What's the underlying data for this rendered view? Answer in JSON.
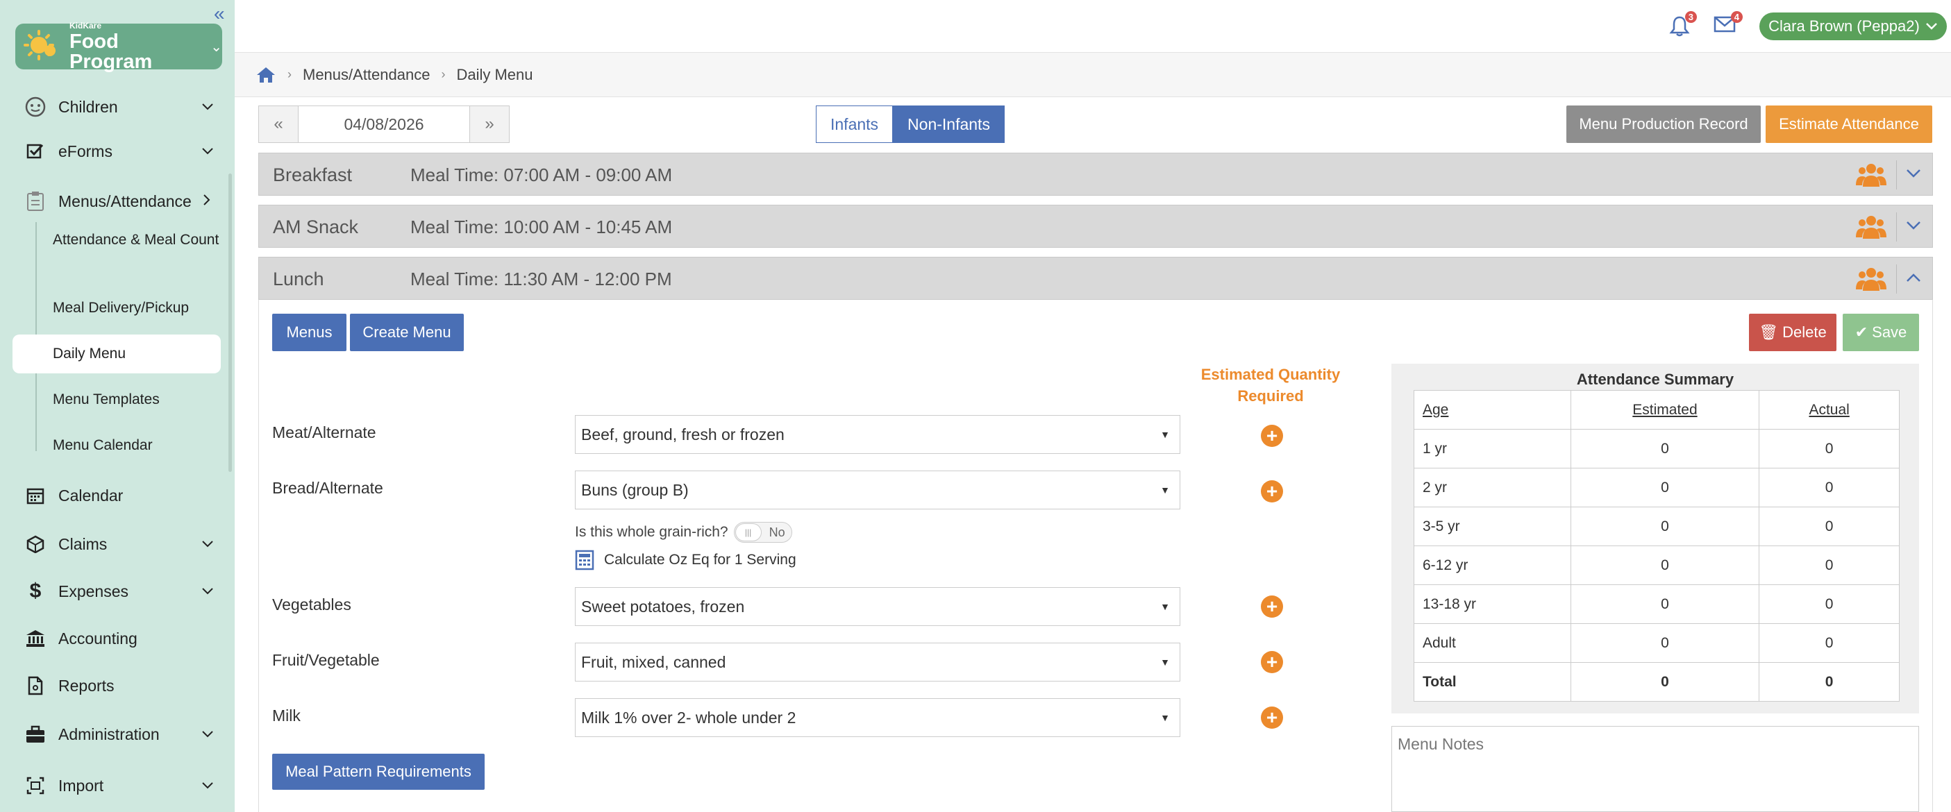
{
  "sidebar": {
    "logo_small": "KidKare",
    "logo_big": "Food Program",
    "items": [
      {
        "label": "Children"
      },
      {
        "label": "eForms"
      },
      {
        "label": "Menus/Attendance"
      },
      {
        "label": "Calendar"
      },
      {
        "label": "Claims"
      },
      {
        "label": "Expenses"
      },
      {
        "label": "Accounting"
      },
      {
        "label": "Reports"
      },
      {
        "label": "Administration"
      },
      {
        "label": "Import"
      }
    ],
    "sub_items": [
      {
        "label": "Attendance & Meal Count"
      },
      {
        "label": "Meal Delivery/Pickup"
      },
      {
        "label": "Daily Menu"
      },
      {
        "label": "Menu Templates"
      },
      {
        "label": "Menu Calendar"
      }
    ]
  },
  "header": {
    "notification_count": "3",
    "message_count": "4",
    "user_name": "Clara Brown (Peppa2)"
  },
  "breadcrumb": [
    "Menus/Attendance",
    "Daily Menu"
  ],
  "date": "04/08/2026",
  "toggle": {
    "infants": "Infants",
    "non_infants": "Non-Infants",
    "active": "Non-Infants"
  },
  "buttons": {
    "menu_production": "Menu Production Record",
    "estimate_attendance": "Estimate Attendance",
    "menus": "Menus",
    "create_menu": "Create Menu",
    "delete": "Delete",
    "save": "Save",
    "meal_pattern": "Meal Pattern Requirements"
  },
  "meals": [
    {
      "name": "Breakfast",
      "time": "Meal Time: 07:00 AM - 09:00 AM",
      "expanded": false
    },
    {
      "name": "AM Snack",
      "time": "Meal Time: 10:00 AM - 10:45 AM",
      "expanded": false
    },
    {
      "name": "Lunch",
      "time": "Meal Time: 11:30 AM - 12:00 PM",
      "expanded": true
    }
  ],
  "lunch": {
    "est_qty_heading": "Estimated Quantity Required",
    "components": [
      {
        "label": "Meat/Alternate",
        "value": "Beef, ground, fresh or frozen"
      },
      {
        "label": "Bread/Alternate",
        "value": "Buns (group B)"
      },
      {
        "label": "Vegetables",
        "value": "Sweet potatoes, frozen"
      },
      {
        "label": "Fruit/Vegetable",
        "value": "Fruit, mixed, canned"
      },
      {
        "label": "Milk",
        "value": "Milk 1% over 2- whole under 2"
      }
    ],
    "whole_grain_question": "Is this whole grain-rich?",
    "whole_grain_value": "No",
    "calc_label": "Calculate Oz Eq for 1 Serving"
  },
  "attendance": {
    "title": "Attendance Summary",
    "headers": [
      "Age",
      "Estimated",
      "Actual"
    ],
    "rows": [
      [
        "1 yr",
        "0",
        "0"
      ],
      [
        "2 yr",
        "0",
        "0"
      ],
      [
        "3-5 yr",
        "0",
        "0"
      ],
      [
        "6-12 yr",
        "0",
        "0"
      ],
      [
        "13-18 yr",
        "0",
        "0"
      ],
      [
        "Adult",
        "0",
        "0"
      ],
      [
        "Total",
        "0",
        "0"
      ]
    ]
  },
  "menu_notes_placeholder": "Menu Notes",
  "colors": {
    "sidebar_bg": "#cfe8df",
    "primary": "#4a6fb5",
    "accent_orange": "#ec8a2c",
    "delete_red": "#c9544b",
    "save_green": "#8fc48f",
    "gray_btn": "#8e8e8e"
  }
}
